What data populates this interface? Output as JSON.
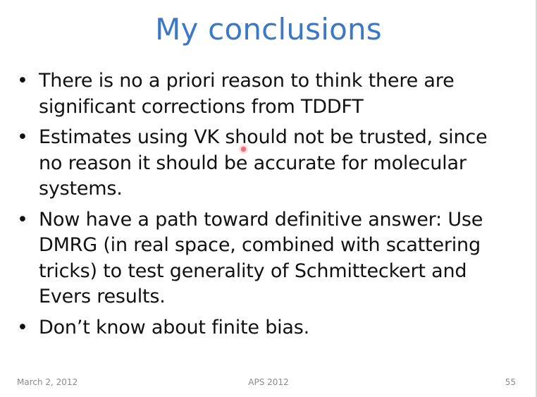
{
  "slide": {
    "title": "My conclusions",
    "bullets": [
      {
        "marker": "•",
        "lines": [
          "There is no a priori reason to think there are",
          "significant corrections from TDDFT"
        ]
      },
      {
        "marker": "•",
        "lines": [
          "Estimates using VK should not be trusted, since",
          "no reason it should be accurate for molecular",
          "systems."
        ]
      },
      {
        "marker": "•",
        "lines": [
          "Now have a path toward definitive answer: Use",
          "DMRG (in real space, combined with scattering",
          "tricks) to test generality of Schmitteckert and",
          "Evers results."
        ]
      },
      {
        "marker": "•",
        "lines": [
          "Don’t know about finite bias."
        ]
      }
    ]
  },
  "footer": {
    "date": "March 2, 2012",
    "center": "APS 2012",
    "page_number": "55"
  },
  "colors": {
    "title": "#3c78c6",
    "body_text": "#111111",
    "footer_text": "#8a8a8a",
    "pointer": "#e8707a"
  },
  "icons": {
    "pointer": "laser-pointer-dot"
  }
}
